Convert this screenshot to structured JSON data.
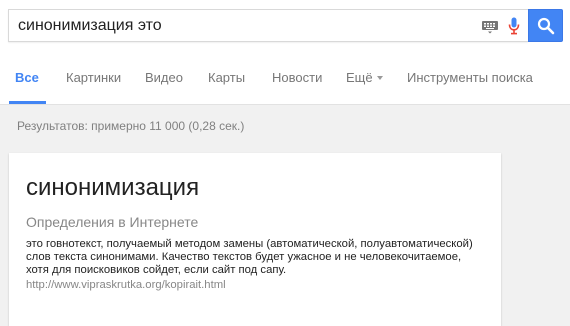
{
  "search": {
    "query": "синонимизация это"
  },
  "colors": {
    "accent": "#4285f4",
    "mic_red": "#ea4335"
  },
  "tabs": [
    {
      "label": "Все",
      "active": true
    },
    {
      "label": "Картинки"
    },
    {
      "label": "Видео"
    },
    {
      "label": "Карты"
    },
    {
      "label": "Новости"
    },
    {
      "label": "Ещё",
      "dropdown": true
    },
    {
      "label": "Инструменты поиска"
    }
  ],
  "results": {
    "stats": "Результатов: примерно 11 000 (0,28 сек.)"
  },
  "card": {
    "term": "синонимизация",
    "subtitle": "Определения в Интернете",
    "definition": "это говнотекст, получаемый методом замены (автоматической, полуавтоматической) слов текста синонимами. Качество текстов будет ужасное и не человекочитаемое, хотя для поисковиков сойдет, если сайт под сапу.",
    "source_url": "http://www.vipraskrutka.org/kopirait.html"
  },
  "icons": [
    "keyboard-icon",
    "microphone-icon",
    "search-icon",
    "chevron-down-icon"
  ]
}
